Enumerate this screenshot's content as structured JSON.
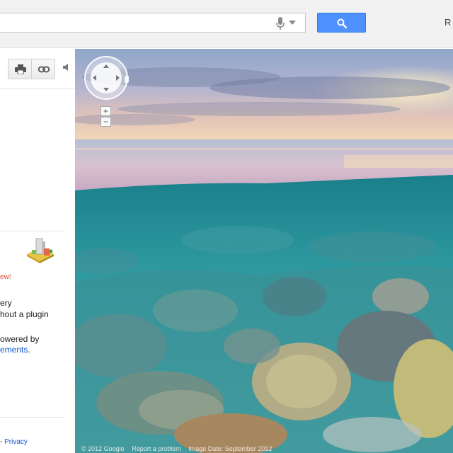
{
  "header": {
    "right_label": "R",
    "icons": {
      "mic": "microphone-icon",
      "dropdown": "caret-down-icon",
      "search": "magnifier-icon"
    },
    "accent_color": "#4d90fe"
  },
  "panel": {
    "toolbar_icons": [
      "print-icon",
      "link-icon"
    ],
    "new_badge": "ew!",
    "line1": "ery",
    "line2": "hout a plugin",
    "line3": "owered by",
    "line4_link": "ements",
    "line4_end": ".",
    "footer_sep": "- ",
    "footer_link": "Privacy"
  },
  "streetview": {
    "zoom_in": "+",
    "zoom_out": "−",
    "footer": {
      "copyright": "© 2012 Google",
      "report": "Report a problem",
      "image_date": "Image Date: September 2012"
    }
  }
}
